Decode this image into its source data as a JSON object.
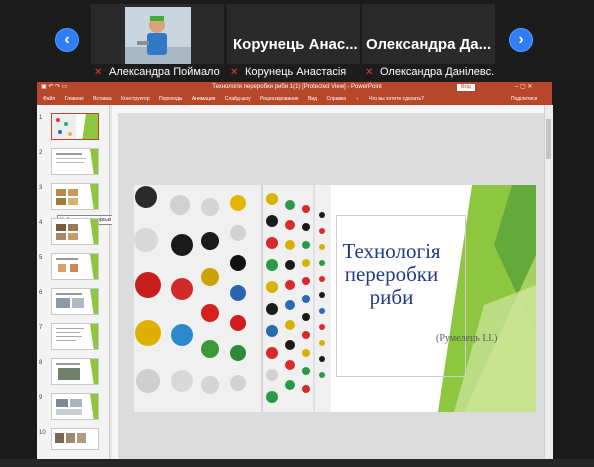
{
  "participants": {
    "prev_button": "‹",
    "next_button": "›",
    "tiles": [
      {
        "display_name": "",
        "label": "Александра Поймало"
      },
      {
        "display_name": "Корунець Анас...",
        "label": "Корунець Анастасія"
      },
      {
        "display_name": "Олександра Да...",
        "label": "Олександра Данілевс..."
      }
    ]
  },
  "powerpoint": {
    "window_title": "Технологія переробки риби 1(1) [Protected View] - PowerPoint",
    "signin": "Вхід",
    "share": "Поділитися",
    "tabs": [
      "Файл",
      "Главная",
      "Вставка",
      "Конструктор",
      "Переходы",
      "Анимация",
      "Слайд-шоу",
      "Рецензирование",
      "Вид",
      "Справка",
      "Что вы хотите сделать?"
    ],
    "tooltip": "Найвживаніші морські пром...",
    "slide_numbers": [
      "1",
      "2",
      "3",
      "4",
      "5",
      "6",
      "7",
      "8",
      "9",
      "10"
    ]
  },
  "slide": {
    "title_line1": "Технологія",
    "title_line2": "переробки",
    "title_line3": "риби",
    "author": "(Румелець І.І.)"
  },
  "colors": {
    "ppt_accent": "#b7472a",
    "title": "#1f3b86",
    "green": "#8dc63f",
    "zoom_blue": "#2f7ef5"
  }
}
